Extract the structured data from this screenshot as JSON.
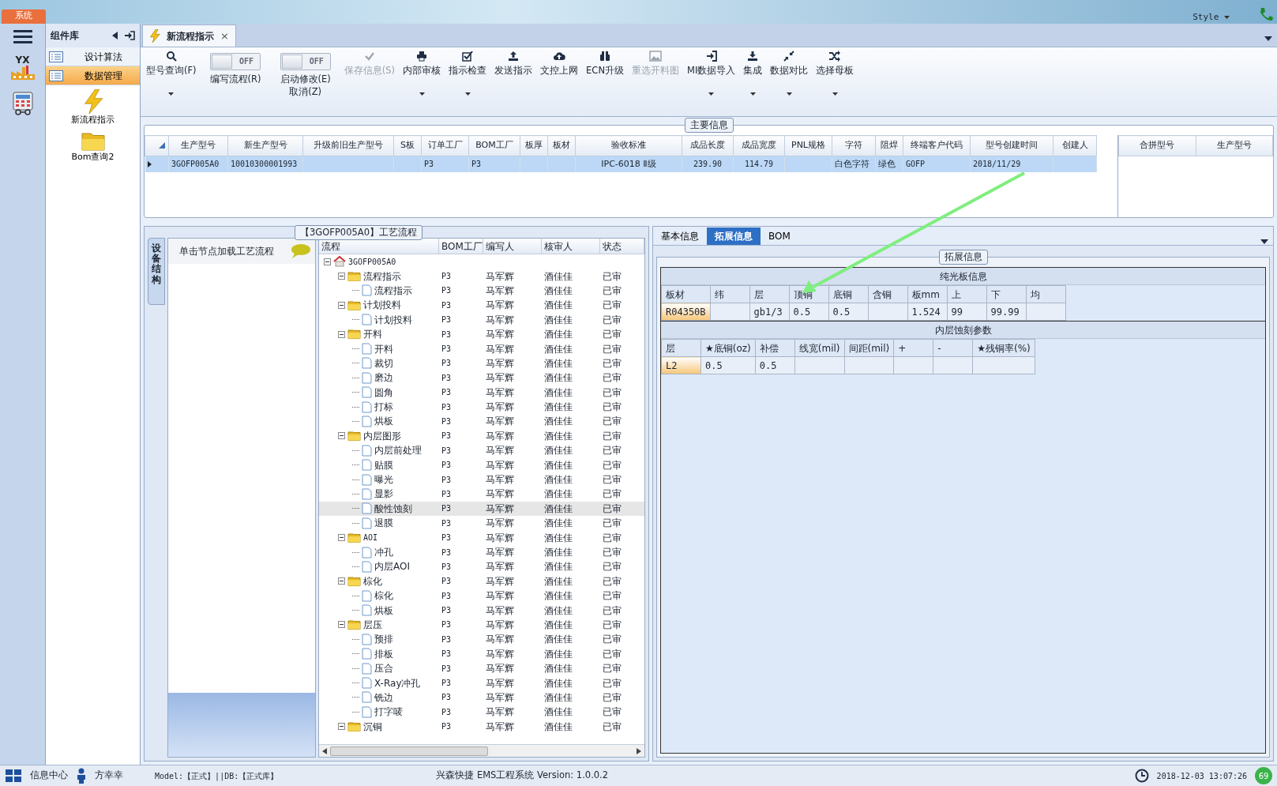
{
  "top_bar": {
    "system_tab": "系统",
    "style_menu": "Style"
  },
  "nav": {
    "logo_text": "YX"
  },
  "component_library": {
    "title": "组件库",
    "items": [
      {
        "label": "设计算法",
        "selected": false
      },
      {
        "label": "数据管理",
        "selected": true
      }
    ],
    "launchers": [
      {
        "label": "新流程指示",
        "kind": "bolt"
      },
      {
        "label": "Bom查询2",
        "kind": "folder"
      }
    ]
  },
  "document_tab": {
    "title": "新流程指示",
    "close": "×"
  },
  "toolbar": {
    "items": [
      {
        "kind": "button",
        "label": "型号查询(F)",
        "caret": true,
        "disabled": false
      },
      {
        "kind": "toggle",
        "label": "编写流程(R)",
        "toggle_text": "OFF",
        "on": false
      },
      {
        "kind": "toggle",
        "label": "启动修改(E)\n取消(Z)",
        "toggle_text": "OFF",
        "on": false
      },
      {
        "kind": "button",
        "label": "保存信息(S)",
        "caret": false,
        "disabled": true
      },
      {
        "kind": "button",
        "label": "内部审核",
        "caret": true,
        "disabled": false
      },
      {
        "kind": "button",
        "label": "指示检查",
        "caret": true,
        "disabled": false
      },
      {
        "kind": "button",
        "label": "发送指示",
        "caret": false,
        "disabled": false
      },
      {
        "kind": "button",
        "label": "文控上网",
        "caret": false,
        "disabled": false
      },
      {
        "kind": "button",
        "label": "ECN升级",
        "caret": false,
        "disabled": false
      },
      {
        "kind": "button",
        "label": "重选开料图",
        "caret": false,
        "disabled": true
      },
      {
        "kind": "button",
        "label": "MI数据导入",
        "caret": true,
        "disabled": false
      },
      {
        "kind": "button",
        "label": "集成",
        "caret": true,
        "disabled": false
      },
      {
        "kind": "button",
        "label": "数据对比",
        "caret": true,
        "disabled": false
      },
      {
        "kind": "button",
        "label": "选择母板",
        "caret": true,
        "disabled": false
      }
    ]
  },
  "main_info": {
    "caption": "主要信息",
    "table": {
      "columns": [
        "生产型号",
        "新生产型号",
        "升级前旧生产型号",
        "S板",
        "订单工厂",
        "BOM工厂",
        "板厚",
        "板材",
        "验收标准",
        "成品长度",
        "成品宽度",
        "PNL规格",
        "字符",
        "阻焊",
        "终端客户代码",
        "型号创建时间",
        "创建人"
      ],
      "rows": [
        {
          "selected": true,
          "cells": [
            "3GOFP005A0",
            "10010300001993",
            null,
            null,
            "P3",
            "P3",
            null,
            null,
            "IPC-6018 Ⅱ级",
            "239.90",
            "114.79",
            null,
            "白色字符",
            "绿色",
            "GOFP",
            "2018/11/29",
            null
          ]
        }
      ]
    },
    "side_table": {
      "columns": [
        "合拼型号",
        "生产型号"
      ]
    }
  },
  "process": {
    "caption": "【3GOFP005A0】工艺流程",
    "side_tab": "设备结构",
    "hint": "单击节点加载工艺流程",
    "columns": [
      "流程",
      "BOM工厂",
      "编写人",
      "核审人",
      "状态"
    ],
    "tree": {
      "label": "3GOFP005A0",
      "kind": "root",
      "expanded": true,
      "selected": false,
      "children": [
        {
          "label": "流程指示",
          "kind": "folder",
          "expanded": true,
          "selected": false,
          "bom": "P3",
          "writer": "马军辉",
          "reviewer": "酒佳佳",
          "status": "已审",
          "children": [
            {
              "label": "流程指示",
              "kind": "doc",
              "selected": false,
              "bom": "P3",
              "writer": "马军辉",
              "reviewer": "酒佳佳",
              "status": "已审"
            }
          ]
        },
        {
          "label": "计划投料",
          "kind": "folder",
          "expanded": true,
          "selected": false,
          "bom": "P3",
          "writer": "马军辉",
          "reviewer": "酒佳佳",
          "status": "已审",
          "children": [
            {
              "label": "计划投料",
              "kind": "doc",
              "selected": false,
              "bom": "P3",
              "writer": "马军辉",
              "reviewer": "酒佳佳",
              "status": "已审"
            }
          ]
        },
        {
          "label": "开料",
          "kind": "folder",
          "expanded": true,
          "selected": false,
          "bom": "P3",
          "writer": "马军辉",
          "reviewer": "酒佳佳",
          "status": "已审",
          "children": [
            {
              "label": "开料",
              "kind": "doc",
              "selected": false,
              "bom": "P3",
              "writer": "马军辉",
              "reviewer": "酒佳佳",
              "status": "已审"
            },
            {
              "label": "裁切",
              "kind": "doc",
              "selected": false,
              "bom": "P3",
              "writer": "马军辉",
              "reviewer": "酒佳佳",
              "status": "已审"
            },
            {
              "label": "磨边",
              "kind": "doc",
              "selected": false,
              "bom": "P3",
              "writer": "马军辉",
              "reviewer": "酒佳佳",
              "status": "已审"
            },
            {
              "label": "圆角",
              "kind": "doc",
              "selected": false,
              "bom": "P3",
              "writer": "马军辉",
              "reviewer": "酒佳佳",
              "status": "已审"
            },
            {
              "label": "打标",
              "kind": "doc",
              "selected": false,
              "bom": "P3",
              "writer": "马军辉",
              "reviewer": "酒佳佳",
              "status": "已审"
            },
            {
              "label": "烘板",
              "kind": "doc",
              "selected": false,
              "bom": "P3",
              "writer": "马军辉",
              "reviewer": "酒佳佳",
              "status": "已审"
            }
          ]
        },
        {
          "label": "内层图形",
          "kind": "folder",
          "expanded": true,
          "selected": false,
          "bom": "P3",
          "writer": "马军辉",
          "reviewer": "酒佳佳",
          "status": "已审",
          "children": [
            {
              "label": "内层前处理",
              "kind": "doc",
              "selected": false,
              "bom": "P3",
              "writer": "马军辉",
              "reviewer": "酒佳佳",
              "status": "已审"
            },
            {
              "label": "贴膜",
              "kind": "doc",
              "selected": false,
              "bom": "P3",
              "writer": "马军辉",
              "reviewer": "酒佳佳",
              "status": "已审"
            },
            {
              "label": "曝光",
              "kind": "doc",
              "selected": false,
              "bom": "P3",
              "writer": "马军辉",
              "reviewer": "酒佳佳",
              "status": "已审"
            },
            {
              "label": "显影",
              "kind": "doc",
              "selected": false,
              "bom": "P3",
              "writer": "马军辉",
              "reviewer": "酒佳佳",
              "status": "已审"
            },
            {
              "label": "酸性蚀刻",
              "kind": "doc",
              "selected": true,
              "bom": "P3",
              "writer": "马军辉",
              "reviewer": "酒佳佳",
              "status": "已审"
            },
            {
              "label": "退膜",
              "kind": "doc",
              "selected": false,
              "bom": "P3",
              "writer": "马军辉",
              "reviewer": "酒佳佳",
              "status": "已审"
            }
          ]
        },
        {
          "label": "AOI",
          "kind": "folder",
          "expanded": true,
          "selected": false,
          "bom": "P3",
          "writer": "马军辉",
          "reviewer": "酒佳佳",
          "status": "已审",
          "children": [
            {
              "label": "冲孔",
              "kind": "doc",
              "selected": false,
              "bom": "P3",
              "writer": "马军辉",
              "reviewer": "酒佳佳",
              "status": "已审"
            },
            {
              "label": "内层AOI",
              "kind": "doc",
              "selected": false,
              "bom": "P3",
              "writer": "马军辉",
              "reviewer": "酒佳佳",
              "status": "已审"
            }
          ]
        },
        {
          "label": "棕化",
          "kind": "folder",
          "expanded": true,
          "selected": false,
          "bom": "P3",
          "writer": "马军辉",
          "reviewer": "酒佳佳",
          "status": "已审",
          "children": [
            {
              "label": "棕化",
              "kind": "doc",
              "selected": false,
              "bom": "P3",
              "writer": "马军辉",
              "reviewer": "酒佳佳",
              "status": "已审"
            },
            {
              "label": "烘板",
              "kind": "doc",
              "selected": false,
              "bom": "P3",
              "writer": "马军辉",
              "reviewer": "酒佳佳",
              "status": "已审"
            }
          ]
        },
        {
          "label": "层压",
          "kind": "folder",
          "expanded": true,
          "selected": false,
          "bom": "P3",
          "writer": "马军辉",
          "reviewer": "酒佳佳",
          "status": "已审",
          "children": [
            {
              "label": "预排",
              "kind": "doc",
              "selected": false,
              "bom": "P3",
              "writer": "马军辉",
              "reviewer": "酒佳佳",
              "status": "已审"
            },
            {
              "label": "排板",
              "kind": "doc",
              "selected": false,
              "bom": "P3",
              "writer": "马军辉",
              "reviewer": "酒佳佳",
              "status": "已审"
            },
            {
              "label": "压合",
              "kind": "doc",
              "selected": false,
              "bom": "P3",
              "writer": "马军辉",
              "reviewer": "酒佳佳",
              "status": "已审"
            },
            {
              "label": "X-Ray冲孔",
              "kind": "doc",
              "selected": false,
              "bom": "P3",
              "writer": "马军辉",
              "reviewer": "酒佳佳",
              "status": "已审"
            },
            {
              "label": "铣边",
              "kind": "doc",
              "selected": false,
              "bom": "P3",
              "writer": "马军辉",
              "reviewer": "酒佳佳",
              "status": "已审"
            },
            {
              "label": "打字唛",
              "kind": "doc",
              "selected": false,
              "bom": "P3",
              "writer": "马军辉",
              "reviewer": "酒佳佳",
              "status": "已审"
            }
          ]
        },
        {
          "label": "沉铜",
          "kind": "folder",
          "expanded": true,
          "selected": false,
          "bom": "P3",
          "writer": "马军辉",
          "reviewer": "酒佳佳",
          "status": "已审"
        }
      ]
    }
  },
  "detail": {
    "tabs": [
      {
        "label": "基本信息",
        "selected": false
      },
      {
        "label": "拓展信息",
        "selected": true
      },
      {
        "label": "BOM",
        "selected": false
      }
    ],
    "caption": "拓展信息",
    "sections": [
      {
        "title": "纯光板信息",
        "columns": [
          "板材",
          "纬",
          "层",
          "顶铜",
          "底铜",
          "含铜",
          "板mm",
          "上",
          "下",
          "均"
        ],
        "rows": [
          [
            "R04350B",
            null,
            "gb1/3",
            "0.5",
            "0.5",
            null,
            "1.524",
            "99",
            "99.99",
            null
          ]
        ]
      },
      {
        "title": "内层蚀刻参数",
        "columns": [
          "层",
          "★底铜(oz)",
          "补偿",
          "线宽(mil)",
          "间距(mil)",
          "+",
          "-",
          "★残铜率(%)"
        ],
        "rows": [
          [
            "L2",
            "0.5",
            "0.5",
            null,
            null,
            null,
            null,
            null
          ]
        ]
      }
    ]
  },
  "status_bar": {
    "info_center": "信息中心",
    "user": "方幸幸",
    "model": "Model:【正式】||DB:【正式库】",
    "app": "兴森快捷 EMS工程系统 Version: 1.0.0.2",
    "time": "2018-12-03 13:07:26",
    "badge": "69"
  }
}
